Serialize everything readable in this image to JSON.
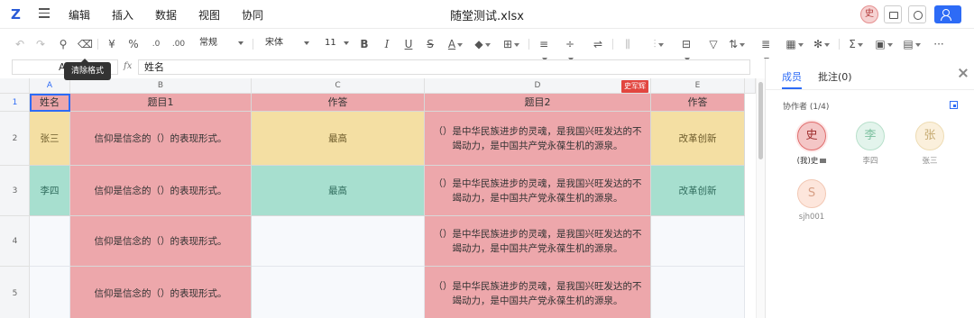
{
  "app": {
    "logo": "Z",
    "menu": [
      "编辑",
      "插入",
      "数据",
      "视图",
      "协同"
    ],
    "document_title": "随堂测试.xlsx",
    "current_user_avatar": "史"
  },
  "toolbar": {
    "currency_symbol": "¥",
    "percent_symbol": "%",
    "decimal_dec": ".0",
    "decimal_inc": ".00",
    "number_format": "常规",
    "font_family": "宋体",
    "font_size": "11",
    "bold": "B",
    "italic": "I",
    "underline": "U",
    "strike": "S",
    "font_color": "A",
    "sum_symbol": "Σ",
    "more": "···",
    "tooltip": "清除格式"
  },
  "formula_bar": {
    "name_box": "A1",
    "fx_label": "fx",
    "content": "姓名"
  },
  "grid": {
    "columns": [
      "A",
      "B",
      "C",
      "D",
      "E"
    ],
    "rows": [
      "1",
      "2",
      "3",
      "4",
      "5"
    ],
    "collaborator_flag": "史军辉",
    "cells": {
      "r1": [
        "姓名",
        "题目1",
        "作答",
        "题目2",
        "作答"
      ],
      "r2": [
        "张三",
        "信仰是信念的（）的表现形式。",
        "最高",
        "（）是中华民族进步的灵魂，是我国兴旺发达的不竭动力，是中国共产党永葆生机的源泉。",
        "改革创新"
      ],
      "r3": [
        "李四",
        "信仰是信念的（）的表现形式。",
        "最高",
        "（）是中华民族进步的灵魂，是我国兴旺发达的不竭动力，是中国共产党永葆生机的源泉。",
        "改革创新"
      ],
      "r4": [
        "",
        "信仰是信念的（）的表现形式。",
        "",
        "（）是中华民族进步的灵魂，是我国兴旺发达的不竭动力，是中国共产党永葆生机的源泉。",
        ""
      ],
      "r5": [
        "",
        "信仰是信念的（）的表现形式。",
        "",
        "（）是中华民族进步的灵魂，是我国兴旺发达的不竭动力，是中国共产党永葆生机的源泉。",
        ""
      ]
    },
    "colors": {
      "pink": "#eda7ab",
      "yellow": "#f4dfa3",
      "teal": "#a7dfcf",
      "selection": "#2d6bf6",
      "collaborator": "#e2463f"
    }
  },
  "panel": {
    "tabs": [
      "成员",
      "批注(0)"
    ],
    "collaborators_label": "协作者 (1/4)",
    "members": [
      {
        "initial": "史",
        "name": "(我)史"
      },
      {
        "initial": "李",
        "name": "李四"
      },
      {
        "initial": "张",
        "name": "张三"
      },
      {
        "initial": "S",
        "name": "sjh001"
      }
    ]
  }
}
